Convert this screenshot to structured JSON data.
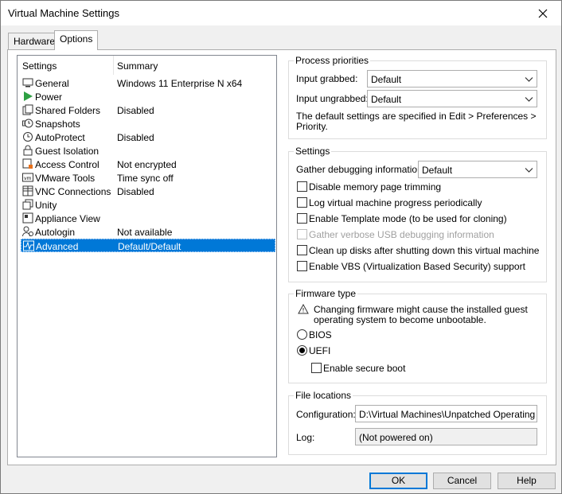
{
  "window": {
    "title": "Virtual Machine Settings"
  },
  "tabs": [
    {
      "label": "Hardware",
      "active": false
    },
    {
      "label": "Options",
      "active": true
    }
  ],
  "settings_list": {
    "columns": [
      "Settings",
      "Summary"
    ],
    "rows": [
      {
        "icon": "monitor-icon",
        "name": "General",
        "summary": "Windows 11 Enterprise N x64"
      },
      {
        "icon": "power-play-icon",
        "name": "Power",
        "summary": ""
      },
      {
        "icon": "shared-folder-icon",
        "name": "Shared Folders",
        "summary": "Disabled"
      },
      {
        "icon": "snapshot-clock-icon",
        "name": "Snapshots",
        "summary": ""
      },
      {
        "icon": "autoprotect-clock-icon",
        "name": "AutoProtect",
        "summary": "Disabled"
      },
      {
        "icon": "lock-icon",
        "name": "Guest Isolation",
        "summary": ""
      },
      {
        "icon": "access-control-icon",
        "name": "Access Control",
        "summary": "Not encrypted"
      },
      {
        "icon": "vmware-tools-icon",
        "name": "VMware Tools",
        "summary": "Time sync off"
      },
      {
        "icon": "vnc-grid-icon",
        "name": "VNC Connections",
        "summary": "Disabled"
      },
      {
        "icon": "unity-icon",
        "name": "Unity",
        "summary": ""
      },
      {
        "icon": "appliance-icon",
        "name": "Appliance View",
        "summary": ""
      },
      {
        "icon": "autologin-users-icon",
        "name": "Autologin",
        "summary": "Not available"
      },
      {
        "icon": "advanced-waveform-icon",
        "name": "Advanced",
        "summary": "Default/Default",
        "selected": true
      }
    ]
  },
  "process_priorities": {
    "title": "Process priorities",
    "input_grabbed_label": "Input grabbed:",
    "input_grabbed_value": "Default",
    "input_ungrabbed_label": "Input ungrabbed:",
    "input_ungrabbed_value": "Default",
    "note_line1": "The default settings are specified in Edit > Preferences >",
    "note_line2": "Priority."
  },
  "settings_group": {
    "title": "Settings",
    "debug_label": "Gather debugging information:",
    "debug_value": "Default",
    "checkboxes": [
      {
        "label": "Disable memory page trimming",
        "checked": false,
        "enabled": true
      },
      {
        "label": "Log virtual machine progress periodically",
        "checked": false,
        "enabled": true
      },
      {
        "label": "Enable Template mode (to be used for cloning)",
        "checked": false,
        "enabled": true
      },
      {
        "label": "Gather verbose USB debugging information",
        "checked": false,
        "enabled": false
      },
      {
        "label": "Clean up disks after shutting down this virtual machine",
        "checked": false,
        "enabled": true
      },
      {
        "label": "Enable VBS (Virtualization Based Security) support",
        "checked": false,
        "enabled": true
      }
    ]
  },
  "firmware": {
    "title": "Firmware type",
    "warning_line1": "Changing firmware might cause the installed guest",
    "warning_line2": "operating system to become unbootable.",
    "bios_label": "BIOS",
    "uefi_label": "UEFI",
    "selected": "UEFI",
    "secure_boot_label": "Enable secure boot",
    "secure_boot_checked": false
  },
  "file_locations": {
    "title": "File locations",
    "configuration_label": "Configuration:",
    "configuration_value": "D:\\Virtual Machines\\Unpatched Operating Syst",
    "log_label": "Log:",
    "log_value": "(Not powered on)"
  },
  "buttons": {
    "ok": "OK",
    "cancel": "Cancel",
    "help": "Help"
  },
  "colors": {
    "selection": "#0078d7",
    "power_green": "#2ea043"
  }
}
